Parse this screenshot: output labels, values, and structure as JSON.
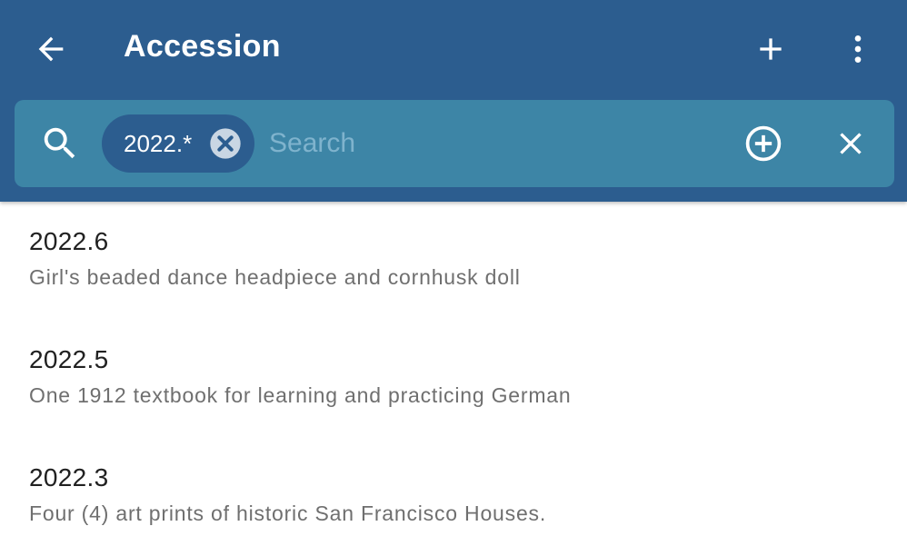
{
  "header": {
    "title": "Accession",
    "back_icon": "arrow-back-icon",
    "add_icon": "plus-icon",
    "more_icon": "more-vertical-icon"
  },
  "search": {
    "chip_label": "2022.*",
    "placeholder": "Search",
    "value": "",
    "search_icon": "search-icon",
    "add_filter_icon": "add-circle-icon",
    "clear_icon": "close-icon"
  },
  "items": [
    {
      "number": "2022.6",
      "description": "Girl's beaded dance headpiece and cornhusk doll"
    },
    {
      "number": "2022.5",
      "description": "One 1912 textbook for learning and practicing German"
    },
    {
      "number": "2022.3",
      "description": "Four (4) art prints of historic San Francisco Houses."
    }
  ],
  "colors": {
    "appbar": "#2c5d8f",
    "searchbar": "#3d85a6",
    "chip": "#2c5d8f"
  }
}
